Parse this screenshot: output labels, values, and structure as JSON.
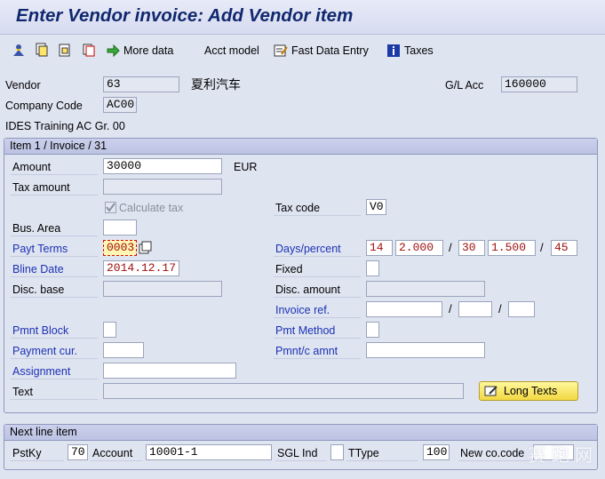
{
  "window": {
    "title": "Enter Vendor invoice: Add Vendor item"
  },
  "toolbar": {
    "icons": [
      "person-icon",
      "copy-icon",
      "paste-icon",
      "document-icon"
    ],
    "more_data": "More data",
    "acct_model": "Acct model",
    "fast_data_entry": "Fast Data Entry",
    "taxes": "Taxes"
  },
  "header": {
    "vendor_label": "Vendor",
    "vendor_value": "63",
    "vendor_name": "夏利汽车",
    "gl_acc_label": "G/L Acc",
    "gl_acc_value": "160000",
    "company_code_label": "Company Code",
    "company_code_value": "AC00",
    "company_name": "IDES Training AC Gr. 00"
  },
  "item_group": {
    "header": "Item 1 / Invoice / 31",
    "amount_label": "Amount",
    "amount_value": "30000",
    "currency": "EUR",
    "tax_amount_label": "Tax amount",
    "tax_amount_value": "",
    "calculate_tax_label": "Calculate tax",
    "calculate_tax_checked": true,
    "tax_code_label": "Tax code",
    "tax_code_value": "V0",
    "bus_area_label": "Bus. Area",
    "bus_area_value": "",
    "payt_terms_label": "Payt Terms",
    "payt_terms_value": "0003",
    "days_percent_label": "Days/percent",
    "days1": "14",
    "pct1": "2.000",
    "days2": "30",
    "pct2": "1.500",
    "days3": "45",
    "bline_date_label": "Bline Date",
    "bline_date_value": "2014.12.17",
    "fixed_label": "Fixed",
    "disc_base_label": "Disc. base",
    "disc_base_value": "",
    "disc_amount_label": "Disc. amount",
    "disc_amount_value": "",
    "invoice_ref_label": "Invoice ref.",
    "invoice_ref_1": "",
    "invoice_ref_2": "",
    "invoice_ref_3": "",
    "pmnt_block_label": "Pmnt Block",
    "pmt_method_label": "Pmt Method",
    "payment_cur_label": "Payment cur.",
    "pmnt_c_amnt_label": "Pmnt/c amnt",
    "assignment_label": "Assignment",
    "text_label": "Text",
    "long_texts_button": "Long Texts"
  },
  "next_line": {
    "header": "Next line item",
    "pstky_label": "PstKy",
    "pstky_value": "70",
    "account_label": "Account",
    "account_value": "10001-1",
    "sgl_ind_label": "SGL Ind",
    "ttype_label": "TType",
    "ttype_value": "100",
    "new_co_code_label": "New co.code"
  },
  "watermark": {
    "text": "赛 跑 网"
  }
}
